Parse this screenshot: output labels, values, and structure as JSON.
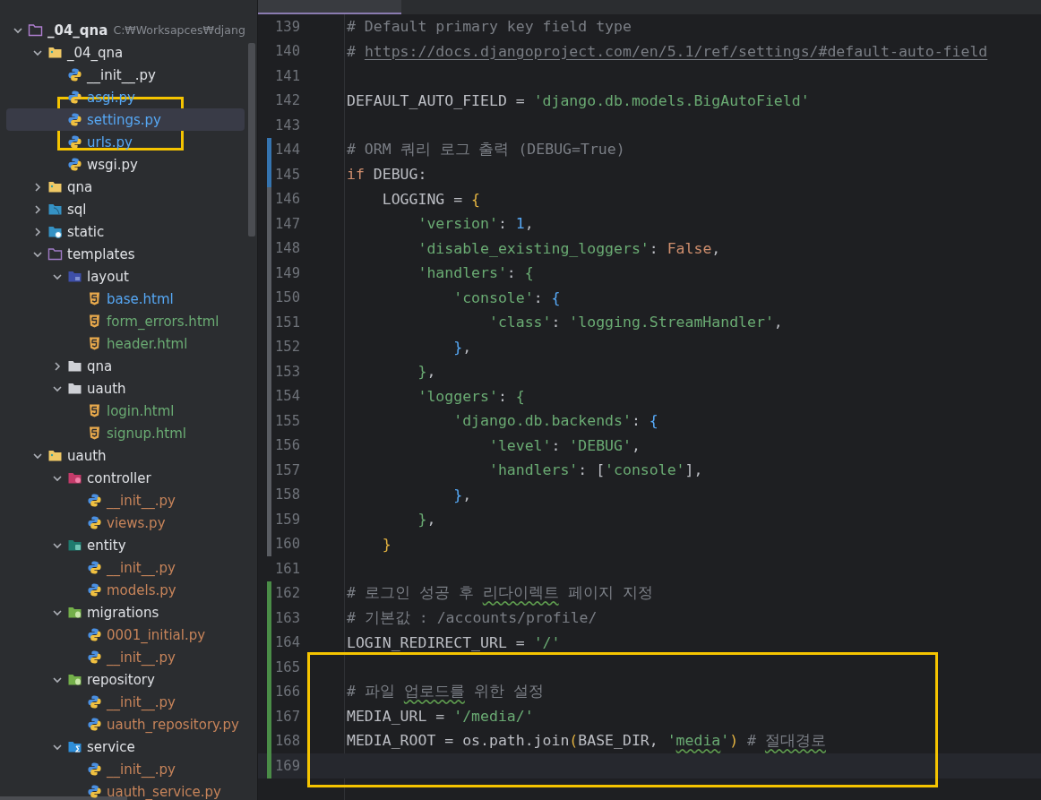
{
  "project_tree": {
    "items": [
      {
        "name": "_04_qna",
        "path": "C:₩Worksapces₩djang",
        "kind": "project",
        "color": "#dfe1e5",
        "expanded": true,
        "selected": false,
        "children": [
          {
            "name": "_04_qna",
            "kind": "package",
            "color": "#dfe1e5",
            "expanded": true,
            "selected": false,
            "children": [
              {
                "name": "__init__.py",
                "kind": "python",
                "color": "#dfe1e5",
                "selected": false
              },
              {
                "name": "asgi.py",
                "kind": "python",
                "color": "#56a8f5",
                "selected": false
              },
              {
                "name": "settings.py",
                "kind": "python",
                "color": "#56a8f5",
                "selected": true,
                "annotated": true
              },
              {
                "name": "urls.py",
                "kind": "python",
                "color": "#56a8f5",
                "selected": false
              },
              {
                "name": "wsgi.py",
                "kind": "python",
                "color": "#dfe1e5",
                "selected": false
              }
            ]
          },
          {
            "name": "qna",
            "kind": "package",
            "color": "#dfe1e5",
            "expanded": false,
            "selected": false
          },
          {
            "name": "sql",
            "kind": "sql",
            "color": "#dfe1e5",
            "expanded": false,
            "selected": false
          },
          {
            "name": "static",
            "kind": "web",
            "color": "#dfe1e5",
            "expanded": false,
            "selected": false
          },
          {
            "name": "templates",
            "kind": "templates",
            "color": "#dfe1e5",
            "expanded": true,
            "selected": false,
            "children": [
              {
                "name": "layout",
                "kind": "layout",
                "color": "#dfe1e5",
                "expanded": true,
                "selected": false,
                "children": [
                  {
                    "name": "base.html",
                    "kind": "html",
                    "color": "#56a8f5",
                    "selected": false
                  },
                  {
                    "name": "form_errors.html",
                    "kind": "html",
                    "color": "#6aab73",
                    "selected": false
                  },
                  {
                    "name": "header.html",
                    "kind": "html",
                    "color": "#6aab73",
                    "selected": false
                  }
                ]
              },
              {
                "name": "qna",
                "kind": "plain",
                "color": "#dfe1e5",
                "expanded": false,
                "selected": false
              },
              {
                "name": "uauth",
                "kind": "plain",
                "color": "#dfe1e5",
                "expanded": true,
                "selected": false,
                "children": [
                  {
                    "name": "login.html",
                    "kind": "html",
                    "color": "#6aab73",
                    "selected": false
                  },
                  {
                    "name": "signup.html",
                    "kind": "html",
                    "color": "#6aab73",
                    "selected": false
                  }
                ]
              }
            ]
          },
          {
            "name": "uauth",
            "kind": "package",
            "color": "#dfe1e5",
            "expanded": true,
            "selected": false,
            "children": [
              {
                "name": "controller",
                "kind": "controller",
                "color": "#dfe1e5",
                "expanded": true,
                "selected": false,
                "children": [
                  {
                    "name": "__init__.py",
                    "kind": "python",
                    "color": "#c7845a",
                    "selected": false
                  },
                  {
                    "name": "views.py",
                    "kind": "python",
                    "color": "#c7845a",
                    "selected": false
                  }
                ]
              },
              {
                "name": "entity",
                "kind": "entity",
                "color": "#dfe1e5",
                "expanded": true,
                "selected": false,
                "children": [
                  {
                    "name": "__init__.py",
                    "kind": "python",
                    "color": "#c7845a",
                    "selected": false
                  },
                  {
                    "name": "models.py",
                    "kind": "python",
                    "color": "#c7845a",
                    "selected": false
                  }
                ]
              },
              {
                "name": "migrations",
                "kind": "database",
                "color": "#dfe1e5",
                "expanded": true,
                "selected": false,
                "children": [
                  {
                    "name": "0001_initial.py",
                    "kind": "python",
                    "color": "#c7845a",
                    "selected": false
                  },
                  {
                    "name": "__init__.py",
                    "kind": "python",
                    "color": "#c7845a",
                    "selected": false
                  }
                ]
              },
              {
                "name": "repository",
                "kind": "database",
                "color": "#dfe1e5",
                "expanded": true,
                "selected": false,
                "children": [
                  {
                    "name": "__init__.py",
                    "kind": "python",
                    "color": "#c7845a",
                    "selected": false
                  },
                  {
                    "name": "uauth_repository.py",
                    "kind": "python",
                    "color": "#c7845a",
                    "selected": false
                  }
                ]
              },
              {
                "name": "service",
                "kind": "service",
                "color": "#dfe1e5",
                "expanded": true,
                "selected": false,
                "children": [
                  {
                    "name": "__init__.py",
                    "kind": "python",
                    "color": "#c7845a",
                    "selected": false
                  },
                  {
                    "name": "uauth_service.py",
                    "kind": "python",
                    "color": "#c7845a",
                    "selected": false
                  }
                ]
              }
            ]
          }
        ]
      }
    ]
  },
  "editor": {
    "lines": [
      {
        "number": "139",
        "tokens": [
          {
            "kind": "comment",
            "text": "# Default primary key field type"
          }
        ]
      },
      {
        "number": "140",
        "tokens": [
          {
            "kind": "comment",
            "text": "# "
          },
          {
            "kind": "link",
            "text": "https://docs.djangoproject.com/en/5.1/ref/settings/#default-auto-field"
          }
        ]
      },
      {
        "number": "141"
      },
      {
        "number": "142",
        "tokens": [
          {
            "kind": "plain",
            "text": "DEFAULT_AUTO_FIELD = "
          },
          {
            "kind": "string",
            "text": "'django.db.models.BigAutoField'"
          }
        ]
      },
      {
        "number": "143"
      },
      {
        "number": "144",
        "color": "#3574b0",
        "tokens": [
          {
            "kind": "comment",
            "text": "# ORM 쿼리 로그 출력 (DEBUG=True)"
          }
        ]
      },
      {
        "number": "145",
        "color": "#3574b0",
        "tokens": [
          {
            "kind": "keyword",
            "text": "if "
          },
          {
            "kind": "plain",
            "text": "DEBUG:"
          }
        ]
      },
      {
        "number": "146",
        "color": "#5a5d63",
        "tokens": [
          {
            "kind": "plain",
            "text": "    LOGGING = "
          },
          {
            "kind": "brace1",
            "text": "{"
          }
        ]
      },
      {
        "number": "147",
        "color": "#5a5d63",
        "tokens": [
          {
            "kind": "string",
            "text": "        'version'"
          },
          {
            "kind": "plain",
            "text": ": "
          },
          {
            "kind": "number",
            "text": "1"
          },
          {
            "kind": "plain",
            "text": ","
          }
        ]
      },
      {
        "number": "148",
        "color": "#5a5d63",
        "tokens": [
          {
            "kind": "string",
            "text": "        'disable_existing_loggers'"
          },
          {
            "kind": "plain",
            "text": ": "
          },
          {
            "kind": "keyword",
            "text": "False"
          },
          {
            "kind": "plain",
            "text": ","
          }
        ]
      },
      {
        "number": "149",
        "color": "#5a5d63",
        "tokens": [
          {
            "kind": "string",
            "text": "        'handlers'"
          },
          {
            "kind": "plain",
            "text": ": "
          },
          {
            "kind": "brace2",
            "text": "{"
          }
        ]
      },
      {
        "number": "150",
        "color": "#5a5d63",
        "tokens": [
          {
            "kind": "string",
            "text": "            'console'"
          },
          {
            "kind": "plain",
            "text": ": "
          },
          {
            "kind": "brace3",
            "text": "{"
          }
        ]
      },
      {
        "number": "151",
        "color": "#5a5d63",
        "tokens": [
          {
            "kind": "string",
            "text": "                'class'"
          },
          {
            "kind": "plain",
            "text": ": "
          },
          {
            "kind": "string",
            "text": "'logging.StreamHandler'"
          },
          {
            "kind": "plain",
            "text": ","
          }
        ]
      },
      {
        "number": "152",
        "color": "#5a5d63",
        "tokens": [
          {
            "kind": "brace3",
            "text": "            }"
          },
          {
            "kind": "plain",
            "text": ","
          }
        ]
      },
      {
        "number": "153",
        "color": "#5a5d63",
        "tokens": [
          {
            "kind": "brace2",
            "text": "        }"
          },
          {
            "kind": "plain",
            "text": ","
          }
        ]
      },
      {
        "number": "154",
        "color": "#5a5d63",
        "tokens": [
          {
            "kind": "string",
            "text": "        'loggers'"
          },
          {
            "kind": "plain",
            "text": ": "
          },
          {
            "kind": "brace2",
            "text": "{"
          }
        ]
      },
      {
        "number": "155",
        "color": "#5a5d63",
        "tokens": [
          {
            "kind": "string",
            "text": "            'django.db.backends'"
          },
          {
            "kind": "plain",
            "text": ": "
          },
          {
            "kind": "brace3",
            "text": "{"
          }
        ]
      },
      {
        "number": "156",
        "color": "#5a5d63",
        "tokens": [
          {
            "kind": "string",
            "text": "                'level'"
          },
          {
            "kind": "plain",
            "text": ": "
          },
          {
            "kind": "string",
            "text": "'DEBUG'"
          },
          {
            "kind": "plain",
            "text": ","
          }
        ]
      },
      {
        "number": "157",
        "color": "#5a5d63",
        "tokens": [
          {
            "kind": "string",
            "text": "                'handlers'"
          },
          {
            "kind": "plain",
            "text": ": ["
          },
          {
            "kind": "string",
            "text": "'console'"
          },
          {
            "kind": "plain",
            "text": "],"
          }
        ]
      },
      {
        "number": "158",
        "color": "#5a5d63",
        "tokens": [
          {
            "kind": "brace3",
            "text": "            }"
          },
          {
            "kind": "plain",
            "text": ","
          }
        ]
      },
      {
        "number": "159",
        "color": "#5a5d63",
        "tokens": [
          {
            "kind": "brace2",
            "text": "        }"
          },
          {
            "kind": "plain",
            "text": ","
          }
        ]
      },
      {
        "number": "160",
        "color": "#5a5d63",
        "tokens": [
          {
            "kind": "brace1",
            "text": "    }"
          }
        ]
      },
      {
        "number": "161"
      },
      {
        "number": "162",
        "color": "#4a8c47",
        "tokens": [
          {
            "kind": "comment",
            "text": "# 로그인 성공 후 "
          },
          {
            "kind": "comment",
            "text": "리다이렉트",
            "typo": true
          },
          {
            "kind": "comment",
            "text": " 페이지 지정"
          }
        ]
      },
      {
        "number": "163",
        "color": "#4a8c47",
        "tokens": [
          {
            "kind": "comment",
            "text": "# 기본값 : /accounts/profile/"
          }
        ]
      },
      {
        "number": "164",
        "color": "#4a8c47",
        "tokens": [
          {
            "kind": "plain",
            "text": "LOGIN_REDIRECT_URL = "
          },
          {
            "kind": "string",
            "text": "'/'"
          }
        ]
      },
      {
        "number": "165",
        "color": "#4a8c47",
        "annotated": true
      },
      {
        "number": "166",
        "color": "#4a8c47",
        "annotated": true,
        "tokens": [
          {
            "kind": "comment",
            "text": "# 파일 "
          },
          {
            "kind": "comment",
            "text": "업로드를",
            "typo": true
          },
          {
            "kind": "comment",
            "text": " 위한 설정"
          }
        ]
      },
      {
        "number": "167",
        "color": "#4a8c47",
        "annotated": true,
        "tokens": [
          {
            "kind": "plain",
            "text": "MEDIA_URL = "
          },
          {
            "kind": "string",
            "text": "'/media/'"
          }
        ]
      },
      {
        "number": "168",
        "color": "#4a8c47",
        "annotated": true,
        "tokens": [
          {
            "kind": "plain",
            "text": "MEDIA_ROOT = os.path.join"
          },
          {
            "kind": "brace1",
            "text": "("
          },
          {
            "kind": "plain",
            "text": "BASE_DIR, "
          },
          {
            "kind": "string",
            "text": "'"
          },
          {
            "kind": "string",
            "text": "media",
            "typo": true
          },
          {
            "kind": "string",
            "text": "'"
          },
          {
            "kind": "brace1",
            "text": ")"
          },
          {
            "kind": "comment",
            "text": " # "
          },
          {
            "kind": "comment",
            "text": "절대경로",
            "typo": true
          }
        ]
      },
      {
        "number": "169",
        "color": "#4a8c47",
        "annotated": true,
        "current": true
      }
    ]
  }
}
